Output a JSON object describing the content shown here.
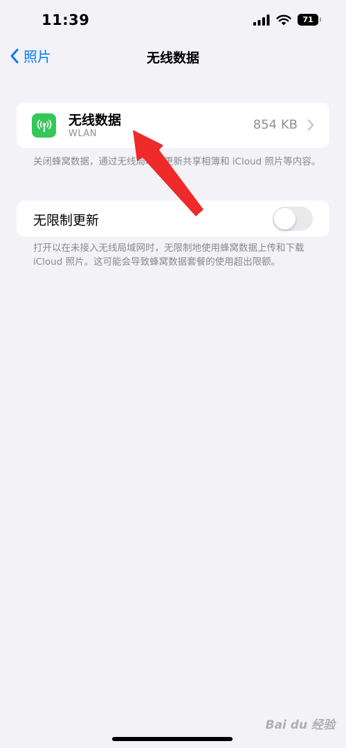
{
  "status_bar": {
    "time": "11:39",
    "battery_level": "71"
  },
  "nav": {
    "back_label": "照片",
    "title": "无线数据"
  },
  "wlan_row": {
    "title": "无线数据",
    "subtitle": "WLAN",
    "value": "854 KB",
    "icon": "antenna-icon",
    "icon_color": "#34c759"
  },
  "footnote_1": "关闭蜂窝数据，通过无线局域网更新共享相簿和 iCloud 照片等内容。",
  "unlimited_row": {
    "label": "无限制更新",
    "toggle_on": false
  },
  "footnote_2": "打开以在未接入无线局域网时，无限制地使用蜂窝数据上传和下载 iCloud 照片。这可能会导致蜂窝数据套餐的使用超出限额。",
  "watermark": "Bai du 经验",
  "colors": {
    "accent": "#007aff",
    "annotation": "#ee2a2a",
    "background": "#f2f2f7"
  }
}
